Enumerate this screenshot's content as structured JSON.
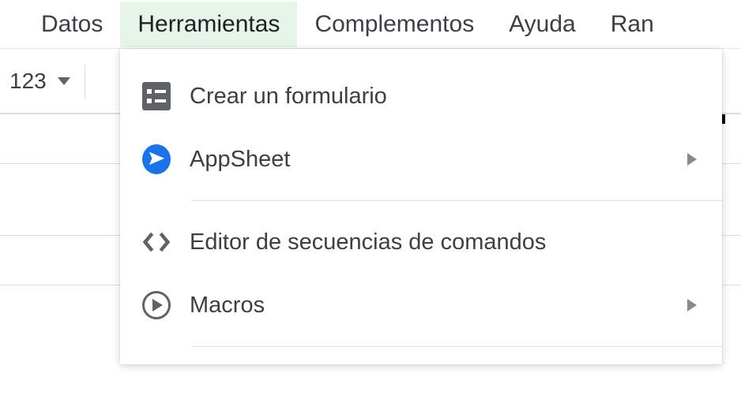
{
  "menubar": {
    "datos": "Datos",
    "herramientas": "Herramientas",
    "complementos": "Complementos",
    "ayuda": "Ayuda",
    "ran": "Ran"
  },
  "toolbar": {
    "format_number": "123"
  },
  "dropdown": {
    "crear_formulario": "Crear un formulario",
    "appsheet": "AppSheet",
    "editor_secuencias": "Editor de secuencias de comandos",
    "macros": "Macros"
  }
}
